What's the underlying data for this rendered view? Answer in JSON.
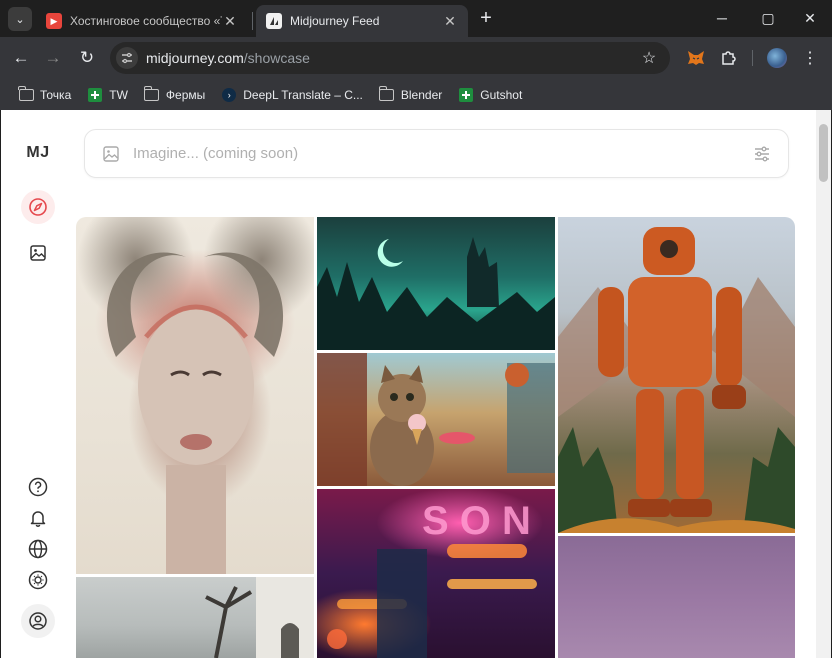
{
  "browser": {
    "tabs": [
      {
        "title": "Хостинговое сообщество «Tim",
        "favicon": "timeweb-favicon",
        "active": false
      },
      {
        "title": "Midjourney Feed",
        "favicon": "midjourney-favicon",
        "active": true
      }
    ],
    "url_host": "midjourney.com",
    "url_path": "/showcase",
    "bookmarks": [
      {
        "label": "Точка",
        "icon": "folder-icon"
      },
      {
        "label": "TW",
        "icon": "sheets-icon"
      },
      {
        "label": "Фермы",
        "icon": "folder-icon"
      },
      {
        "label": "DeepL Translate – C...",
        "icon": "deepl-icon"
      },
      {
        "label": "Blender",
        "icon": "folder-icon"
      },
      {
        "label": "Gutshot",
        "icon": "sheets-icon"
      }
    ]
  },
  "app": {
    "logo": "MJ",
    "imagine_placeholder": "Imagine... (coming soon)",
    "sidebar_icons": [
      "explore-compass-icon",
      "image-icon",
      "help-icon",
      "bell-icon",
      "globe-icon",
      "brightness-icon",
      "account-icon"
    ],
    "accent_color": "#e5484d"
  },
  "gallery": [
    {
      "subject": "horned woman portrait",
      "name": "gallery-image-horned-woman"
    },
    {
      "subject": "dark castle forest with crescent moon",
      "name": "gallery-image-moon-castle"
    },
    {
      "subject": "cat with ice cream in street",
      "name": "gallery-image-cat-icecream"
    },
    {
      "subject": "orange robot in mountains",
      "name": "gallery-image-orange-robot"
    },
    {
      "subject": "neon sign bokeh",
      "name": "gallery-image-neon-sign"
    },
    {
      "subject": "misty tree and house",
      "name": "gallery-image-misty-tree"
    },
    {
      "subject": "purple gradient sky",
      "name": "gallery-image-purple-sky"
    }
  ]
}
